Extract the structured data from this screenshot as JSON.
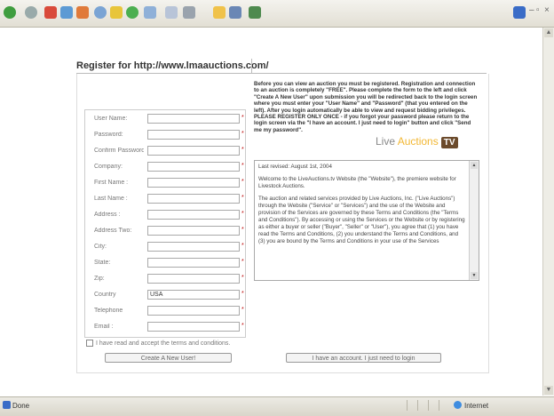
{
  "status": {
    "text": "Done",
    "zone": "Internet"
  },
  "title": "Register for http://www.lmaauctions.com/",
  "form": {
    "fields": [
      {
        "label": "User Name:",
        "value": "",
        "required": true
      },
      {
        "label": "Password:",
        "value": "",
        "required": true
      },
      {
        "label": "Confirm Password:",
        "value": "",
        "required": true
      },
      {
        "label": "Company:",
        "value": "",
        "required": true
      },
      {
        "label": "First Name :",
        "value": "",
        "required": true
      },
      {
        "label": "Last Name :",
        "value": "",
        "required": true
      },
      {
        "label": "Address :",
        "value": "",
        "required": true
      },
      {
        "label": "Address Two:",
        "value": "",
        "required": true
      },
      {
        "label": "City:",
        "value": "",
        "required": true
      },
      {
        "label": "State:",
        "value": "",
        "required": true
      },
      {
        "label": "Zip:",
        "value": "",
        "required": true
      },
      {
        "label": "Country",
        "value": "USA",
        "required": true
      },
      {
        "label": "Telephone",
        "value": "",
        "required": true
      },
      {
        "label": "Email :",
        "value": "",
        "required": true
      }
    ],
    "agree_label": "I have read and accept the terms and conditions.",
    "create_button": "Create A New User!",
    "login_button": "I have an account. I just need to login"
  },
  "intro": "Before you can view an auction you must be registered. Registration and connection to an auction is completely \"FREE\". Please complete the form to the left and click \"Create A New User\" upon submission you will be redirected back to the login screen where you must enter your \"User Name\" and \"Password\" (that you entered on the left). After you login automatically be able to view and request bidding privileges. PLEASE REGISTER ONLY ONCE - if you forgot your password please return to the login screen via the \"I have an account. I just need to login\" button and click \"Send me my password\".",
  "logo": {
    "word1": "Live",
    "word2": "Auctions",
    "badge": "TV"
  },
  "terms": {
    "paragraphs": [
      "Last revised: August 1st, 2004",
      "Welcome to the LiveAuctions.tv Website (the \"Website\"), the premiere website for Livestock Auctions.",
      "The auction and related services provided by Live Auctions, Inc. (\"Live Auctions\") through the Website (\"Service\" or \"Services\") and the use of the Website and provision of the Services are governed by these Terms and Conditions (the \"Terms and Conditions\"). By accessing or using the Services or the Website or by registering as either a buyer or seller (\"Buyer\", \"Seller\" or \"User\"), you agree that (1) you have read the Terms and Conditions, (2) you understand the Terms and Conditions, and (3) you are bound by the Terms and Conditions in your use of the Services"
    ]
  }
}
